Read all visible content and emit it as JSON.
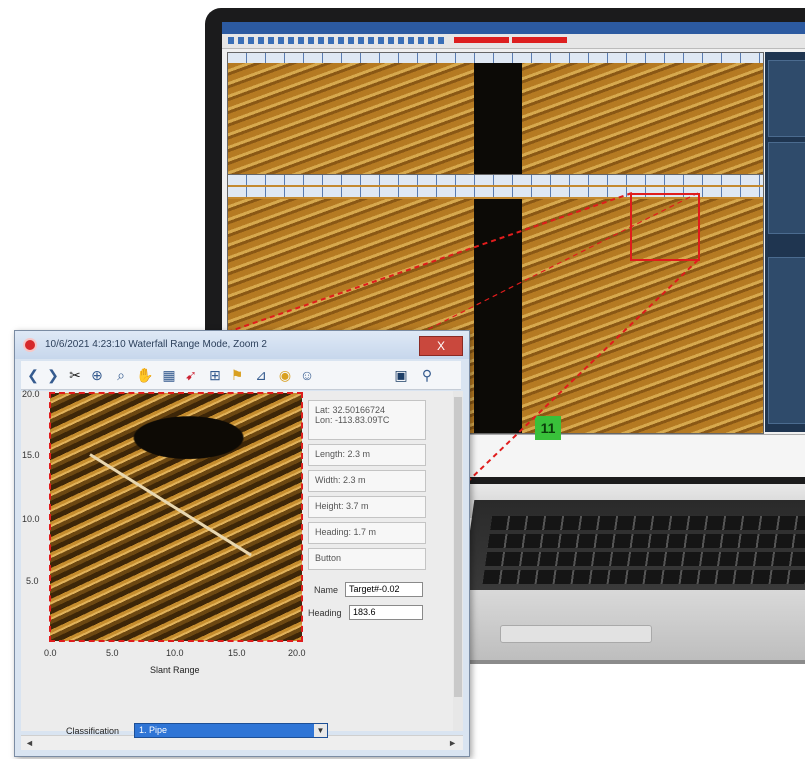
{
  "zoom_window": {
    "title": "10/6/2021 4:23:10 Waterfall Range Mode, Zoom 2",
    "close_label": "X",
    "y_ticks": [
      "20.0",
      "15.0",
      "10.0",
      "5.0"
    ],
    "x_ticks": [
      "0.0",
      "5.0",
      "10.0",
      "15.0",
      "20.0"
    ],
    "x_axis_label": "Slant Range",
    "target_info": {
      "lat": "Lat: 32.50166724",
      "lon": "Lon: -113.83.09TC",
      "length": "Length: 2.3 m",
      "width": "Width: 2.3 m",
      "height": "Height: 3.7 m",
      "heading": "Heading: 1.7 m",
      "button": "Button"
    },
    "name_label": "Name",
    "name_value": "Target#-0.02",
    "heading_label": "Heading",
    "heading_value": "183.6",
    "classification_label": "Classification",
    "classification_value": "1. Pipe",
    "scroll_left": "◄",
    "scroll_right": "►"
  },
  "laptop": {
    "status_indicator": "11"
  },
  "icons": [
    "back-icon",
    "forward-icon",
    "scissors-icon",
    "zoom-icon",
    "magnify-icon",
    "hand-icon",
    "grid-icon",
    "cursor-icon",
    "layout-icon",
    "flag-icon",
    "chart-icon",
    "camera-icon",
    "chat-icon",
    "save-icon",
    "pin-icon"
  ],
  "colors": {
    "highlight_red": "#e01c1c",
    "sonar_amber": "#c48a30",
    "status_green": "#39c03a",
    "selection_blue": "#2f75d6"
  }
}
